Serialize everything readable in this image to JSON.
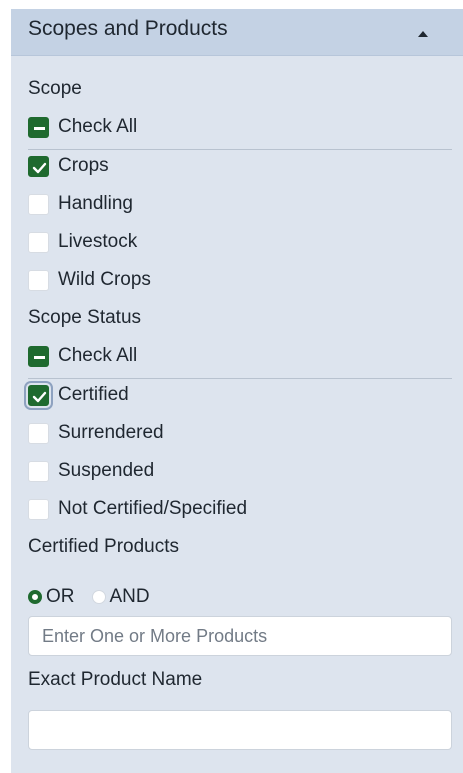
{
  "panel": {
    "title": "Scopes and Products",
    "collapse_icon": "triangle-up-icon"
  },
  "scope": {
    "label": "Scope",
    "check_all": {
      "label": "Check All",
      "state": "mixed"
    },
    "options": [
      {
        "label": "Crops",
        "checked": true
      },
      {
        "label": "Handling",
        "checked": false
      },
      {
        "label": "Livestock",
        "checked": false
      },
      {
        "label": "Wild Crops",
        "checked": false
      }
    ]
  },
  "scope_status": {
    "label": "Scope Status",
    "check_all": {
      "label": "Check All",
      "state": "mixed"
    },
    "options": [
      {
        "label": "Certified",
        "checked": true
      },
      {
        "label": "Surrendered",
        "checked": false
      },
      {
        "label": "Suspended",
        "checked": false
      },
      {
        "label": "Not Certified/Specified",
        "checked": false
      }
    ]
  },
  "certified_products": {
    "label": "Certified Products",
    "logic": [
      {
        "label": "OR",
        "selected": true
      },
      {
        "label": "AND",
        "selected": false
      }
    ],
    "input_placeholder": "Enter One or More Products",
    "input_value": ""
  },
  "exact_product": {
    "label": "Exact Product Name",
    "input_placeholder": "",
    "input_value": ""
  },
  "colors": {
    "accent_green": "#1f6a2f",
    "panel_bg": "#dde4ee",
    "header_bg": "#c4d2e4"
  }
}
